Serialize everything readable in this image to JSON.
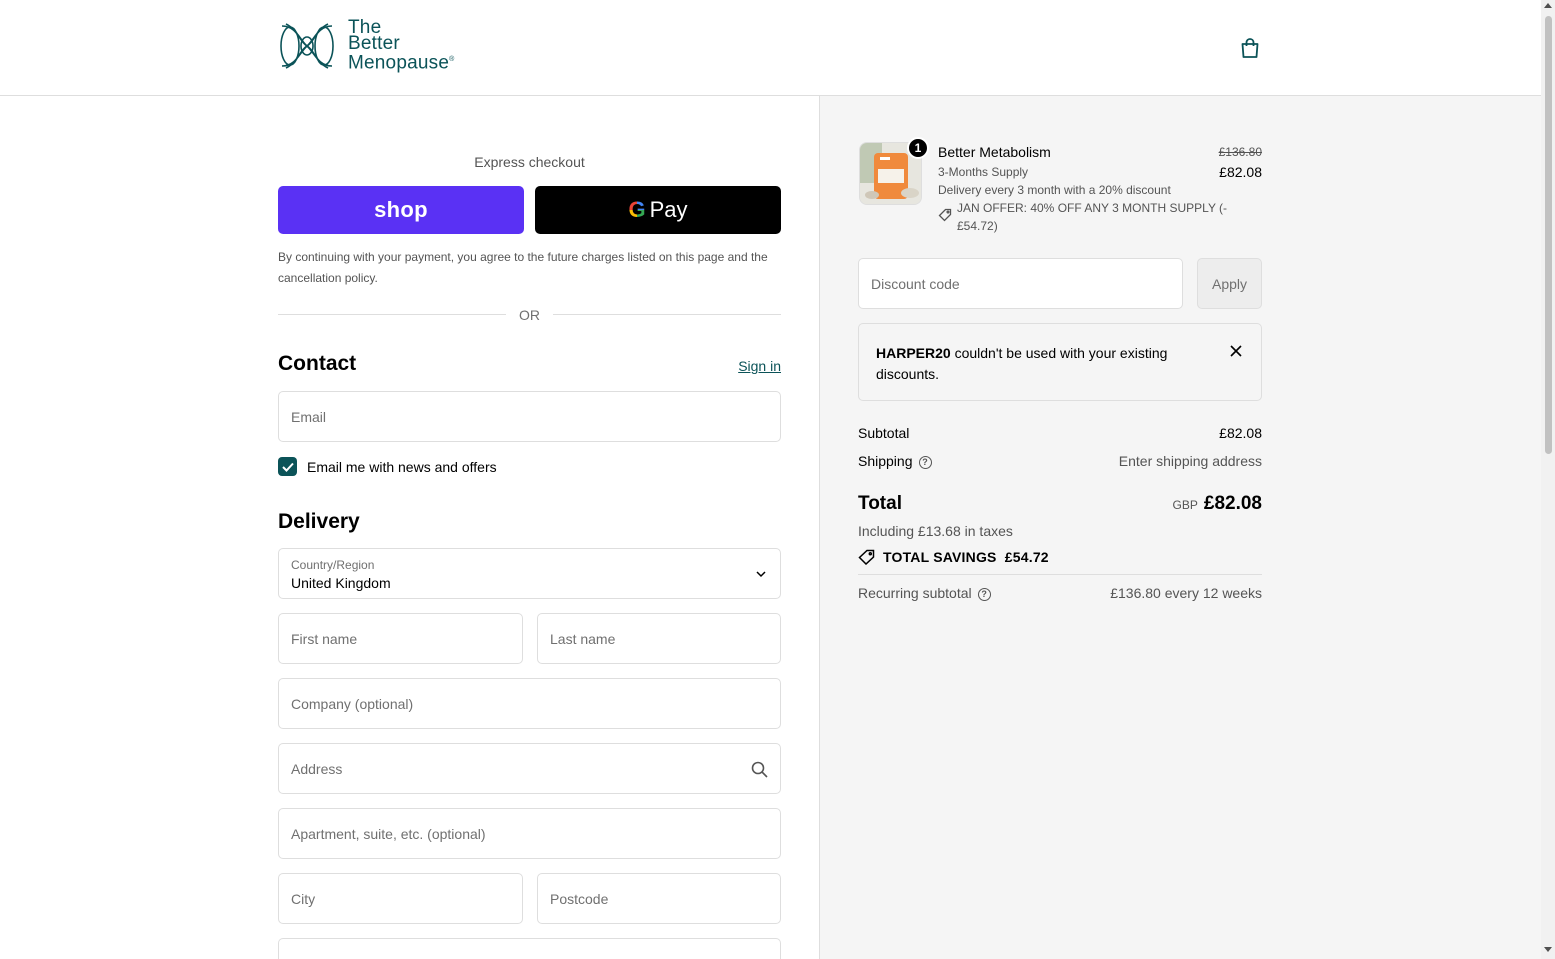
{
  "header": {
    "logo_lines": [
      "The",
      "Better",
      "Menopause"
    ],
    "logo_mark": "®"
  },
  "express": {
    "label": "Express checkout",
    "shop_label": "shop",
    "gpay_g": "G",
    "gpay_label": "Pay",
    "consent": "By continuing with your payment, you agree to the future charges listed on this page and the cancellation policy.",
    "or_label": "OR"
  },
  "contact": {
    "title": "Contact",
    "sign_in": "Sign in",
    "email_placeholder": "Email",
    "news_label": "Email me with news and offers",
    "news_checked": true
  },
  "delivery": {
    "title": "Delivery",
    "country_label": "Country/Region",
    "country_value": "United Kingdom",
    "first_name": "First name",
    "last_name": "Last name",
    "company": "Company (optional)",
    "address": "Address",
    "apartment": "Apartment, suite, etc. (optional)",
    "city": "City",
    "postcode": "Postcode"
  },
  "summary": {
    "quantity": "1",
    "product_name": "Better Metabolism",
    "variant": "3-Months Supply",
    "delivery_note": "Delivery every 3 month with a 20% discount",
    "offer_line1": "JAN OFFER: 40% OFF ANY 3 MONTH SUPPLY (-",
    "offer_line2": "£54.72)",
    "old_price": "£136.80",
    "new_price": "£82.08",
    "discount_placeholder": "Discount code",
    "apply_label": "Apply",
    "notice_code": "HARPER20",
    "notice_text": " couldn't be used with your existing discounts.",
    "subtotal_label": "Subtotal",
    "subtotal_value": "£82.08",
    "shipping_label": "Shipping",
    "shipping_value": "Enter shipping address",
    "help_glyph": "?",
    "total_label": "Total",
    "currency": "GBP",
    "total_value": "£82.08",
    "taxes": "Including £13.68 in taxes",
    "savings_label": "TOTAL SAVINGS",
    "savings_value": "£54.72",
    "recurring_label": "Recurring subtotal",
    "recurring_value": "£136.80 every 12 weeks"
  },
  "colors": {
    "brand": "#0b5358",
    "shop_purple": "#5a31f4",
    "gpay_black": "#000000"
  }
}
